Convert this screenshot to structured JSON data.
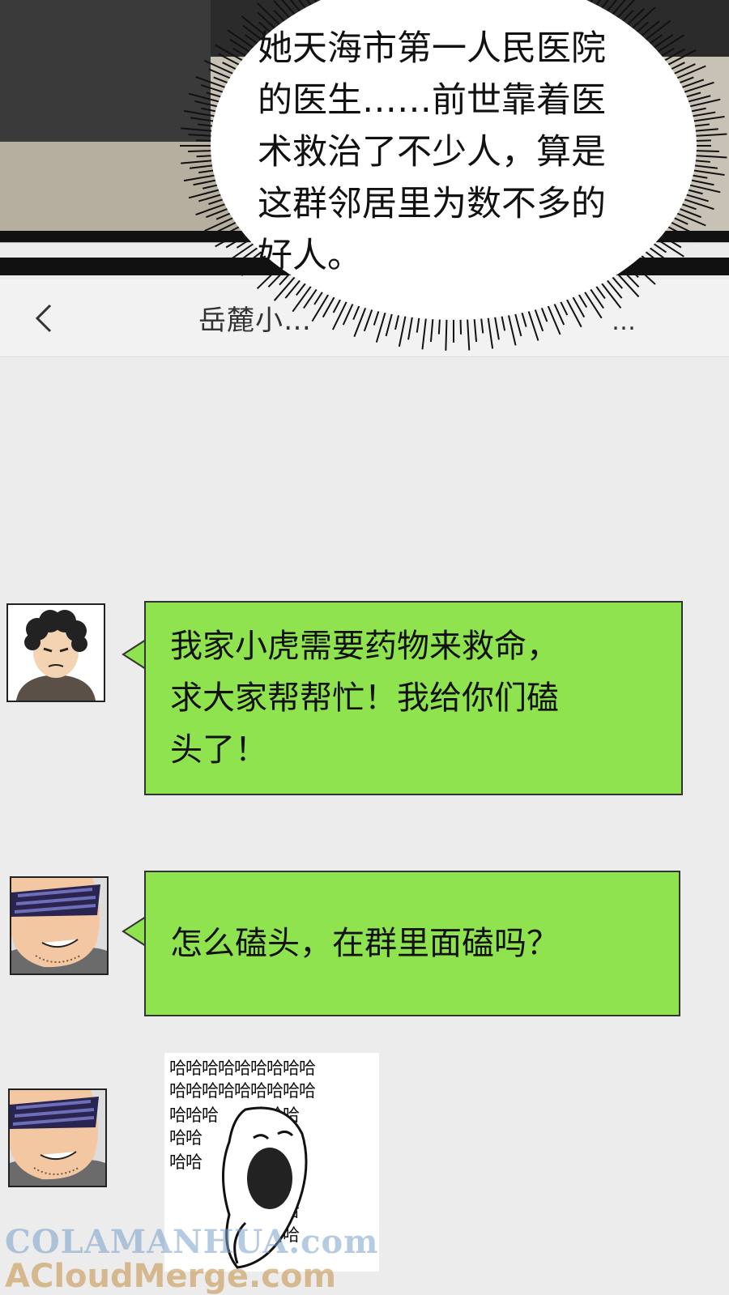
{
  "narration": {
    "lines": [
      "她天海市第一人民医院",
      "的医生……前世靠着医",
      "术救治了不少人，算是",
      "这群邻居里为数不多的",
      "好人。"
    ]
  },
  "chat": {
    "title": "岳麓小…",
    "more": "…"
  },
  "messages": [
    {
      "lines": [
        "我家小虎需要药物来救命，",
        "求大家帮帮忙！我给你们磕",
        "头了！"
      ]
    },
    {
      "lines": [
        "怎么磕头，在群里面磕吗？"
      ]
    }
  ],
  "sticker": {
    "rows": [
      "哈哈哈哈哈哈哈哈哈",
      "哈哈哈哈哈哈哈哈哈",
      "哈哈哈　　哈哈哈",
      "哈哈　　　哈哈哈",
      "哈哈　　　哈哈哈",
      "　　　　哈哈哈哈",
      "　　　　哈哈哈哈",
      "　　　　哈哈哈哈"
    ]
  },
  "watermarks": {
    "line1": "COLAMANHUA.com",
    "line2": "ACloudMerge.com"
  },
  "colors": {
    "bubble_green": "#8fe34e",
    "background": "#ececec"
  }
}
